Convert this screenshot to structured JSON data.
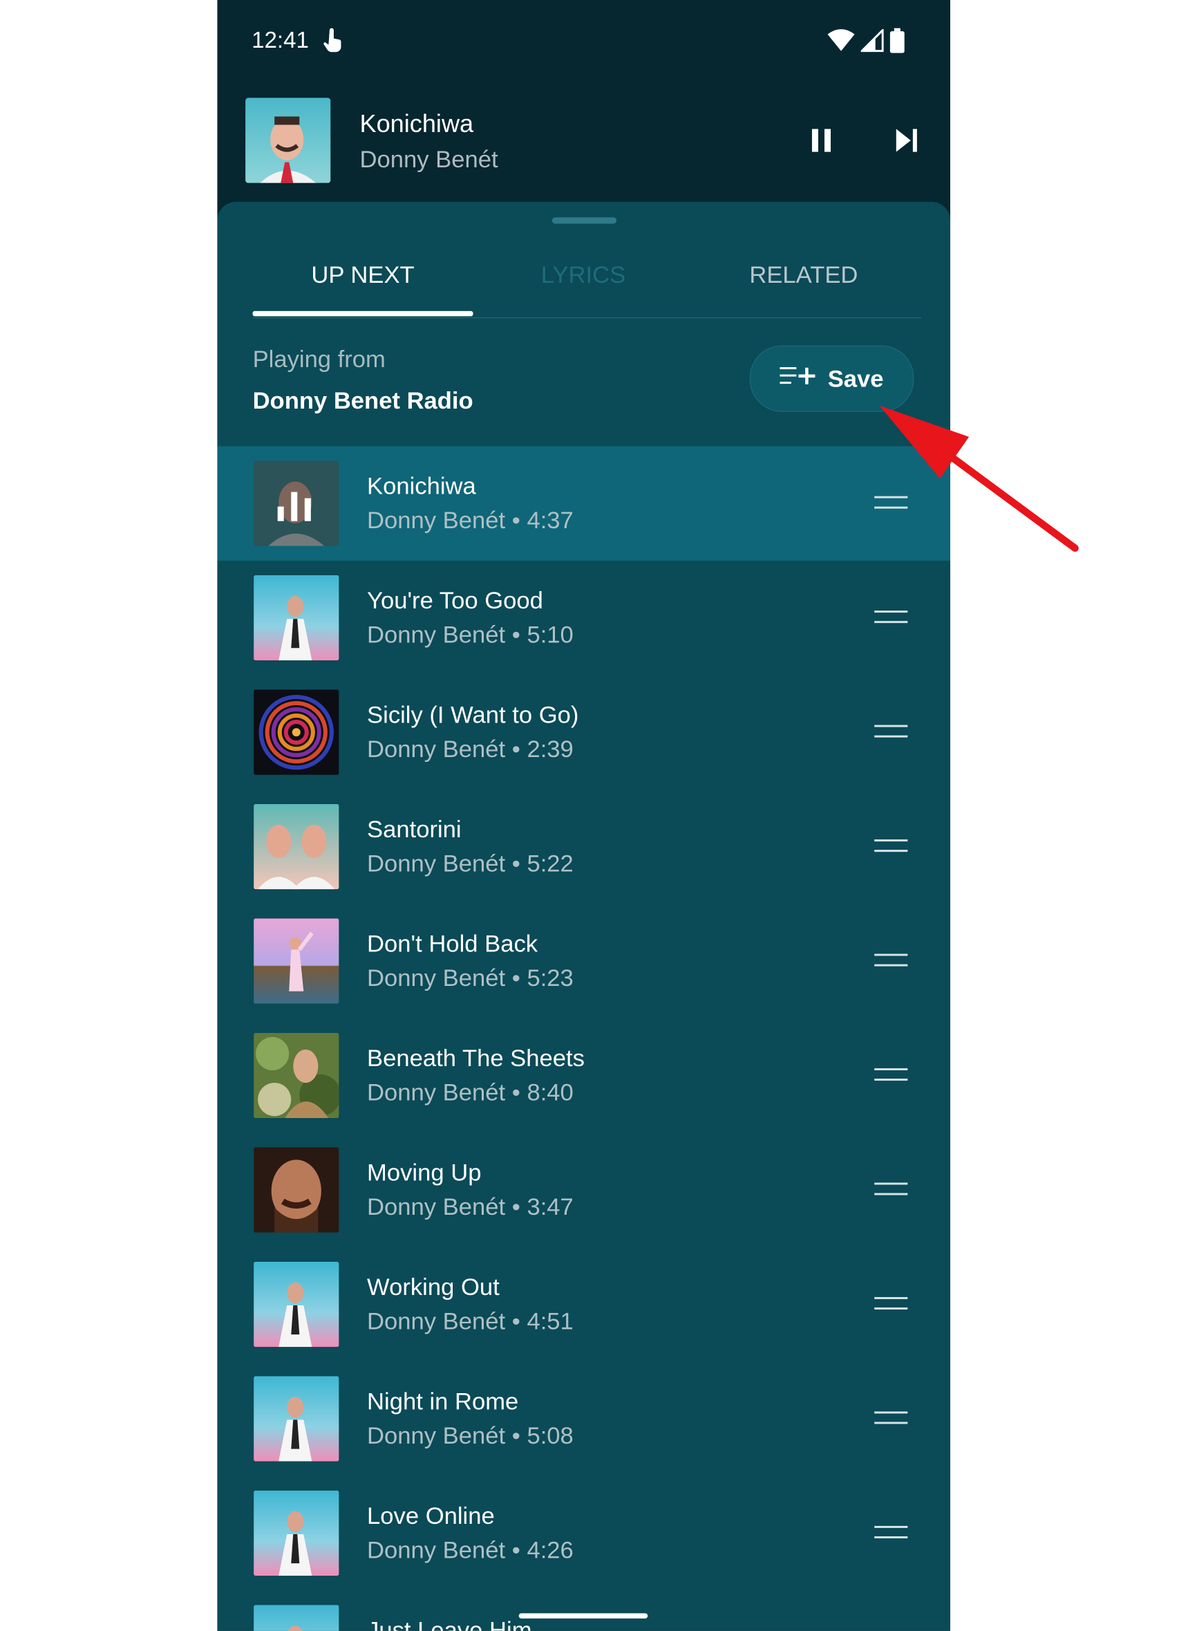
{
  "status_bar": {
    "time": "12:41"
  },
  "now_playing": {
    "title": "Konichiwa",
    "artist": "Donny Benét"
  },
  "tabs": [
    {
      "label": "UP NEXT",
      "selected": true
    },
    {
      "label": "LYRICS",
      "selected": false
    },
    {
      "label": "RELATED",
      "selected": false
    }
  ],
  "playing_from": {
    "label": "Playing from",
    "source": "Donny Benet Radio"
  },
  "save_button": {
    "label": "Save"
  },
  "queue": [
    {
      "title": "Konichiwa",
      "subtitle": "Donny Benét • 4:37",
      "playing": true
    },
    {
      "title": "You're Too Good",
      "subtitle": "Donny Benét • 5:10"
    },
    {
      "title": "Sicily (I Want to Go)",
      "subtitle": "Donny Benét • 2:39"
    },
    {
      "title": "Santorini",
      "subtitle": "Donny Benét • 5:22"
    },
    {
      "title": "Don't Hold Back",
      "subtitle": "Donny Benét • 5:23"
    },
    {
      "title": "Beneath The Sheets",
      "subtitle": "Donny Benét • 8:40"
    },
    {
      "title": "Moving Up",
      "subtitle": "Donny Benét • 3:47"
    },
    {
      "title": "Working Out",
      "subtitle": "Donny Benét • 4:51"
    },
    {
      "title": "Night in Rome",
      "subtitle": "Donny Benét • 5:08"
    },
    {
      "title": "Love Online",
      "subtitle": "Donny Benét • 4:26"
    },
    {
      "title": "Just Leave Him",
      "subtitle": ""
    }
  ],
  "colors": {
    "background": "#062630",
    "sheet": "#0b4a57",
    "active_row": "#0f6678",
    "annotation_arrow": "#e8151b"
  },
  "icons": [
    "touch-icon",
    "wifi-icon",
    "signal-icon",
    "battery-icon",
    "pause-icon",
    "skip-next-icon",
    "playlist-add-icon",
    "drag-handle-icon",
    "equalizer-icon"
  ]
}
